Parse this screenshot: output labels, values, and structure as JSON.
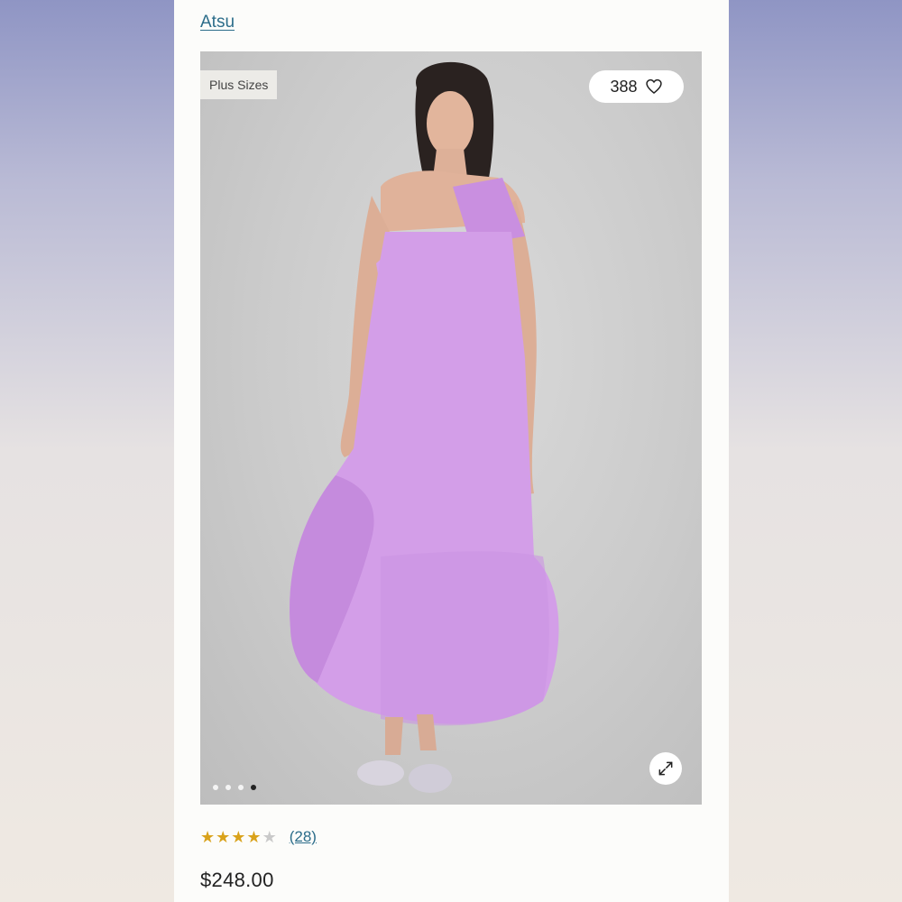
{
  "brand": {
    "label": "Atsu"
  },
  "media": {
    "badge": "Plus Sizes",
    "favorites_count": "388",
    "dots_total": 4,
    "active_dot": 4,
    "dress_color": "#d4a0e6"
  },
  "rating": {
    "stars": 4,
    "max": 5,
    "count_label": "(28)"
  },
  "price": {
    "value": "$248.00"
  }
}
